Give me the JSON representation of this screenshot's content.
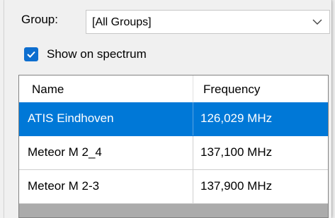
{
  "group": {
    "label": "Group:",
    "selected": "[All Groups]"
  },
  "show_on_spectrum": {
    "label": "Show on spectrum",
    "checked": true
  },
  "table": {
    "columns": [
      "Name",
      "Frequency"
    ],
    "rows": [
      {
        "name": "ATIS Eindhoven",
        "frequency": "126,029 MHz",
        "selected": true
      },
      {
        "name": "Meteor M 2_4",
        "frequency": "137,100 MHz",
        "selected": false
      },
      {
        "name": "Meteor M 2-3",
        "frequency": "137,900 MHz",
        "selected": false
      }
    ]
  },
  "colors": {
    "accent": "#0078d7",
    "checkbox": "#0d6ecf",
    "list_empty": "#ababab"
  }
}
